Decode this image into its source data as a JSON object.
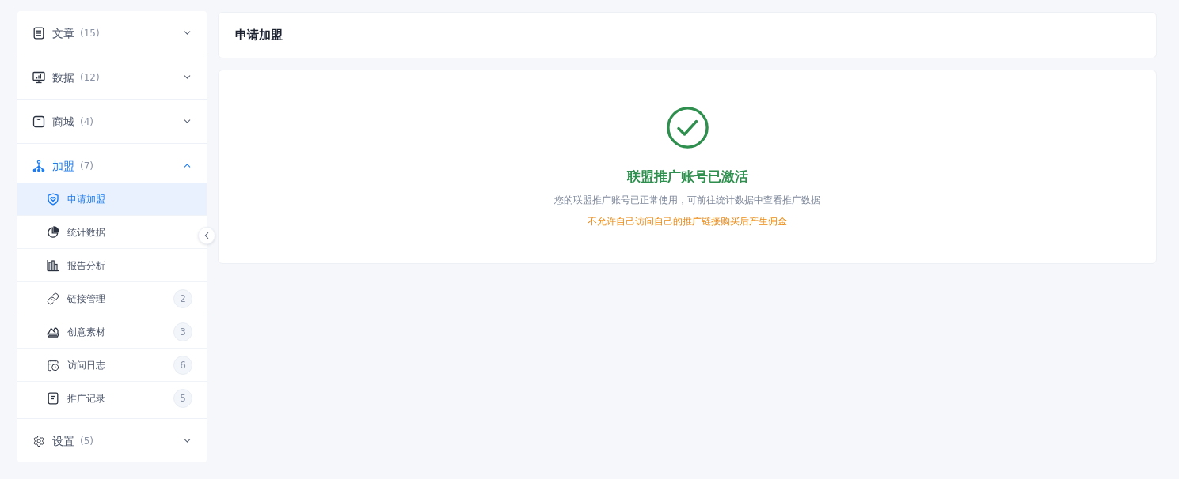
{
  "sidebar": {
    "groups": [
      {
        "label": "文章",
        "count": "(15)",
        "expanded": false,
        "selected": false
      },
      {
        "label": "数据",
        "count": "(12)",
        "expanded": false,
        "selected": false
      },
      {
        "label": "商城",
        "count": "(4)",
        "expanded": false,
        "selected": false
      },
      {
        "label": "加盟",
        "count": "(7)",
        "expanded": true,
        "selected": true,
        "children": [
          {
            "label": "申请加盟",
            "selected": true
          },
          {
            "label": "统计数据",
            "selected": false
          },
          {
            "label": "报告分析",
            "selected": false
          },
          {
            "label": "链接管理",
            "selected": false,
            "badge": "2"
          },
          {
            "label": "创意素材",
            "selected": false,
            "badge": "3"
          },
          {
            "label": "访问日志",
            "selected": false,
            "badge": "6"
          },
          {
            "label": "推广记录",
            "selected": false,
            "badge": "5"
          }
        ]
      },
      {
        "label": "设置",
        "count": "(5)",
        "expanded": false,
        "selected": false
      }
    ]
  },
  "page_header": {
    "title": "申请加盟"
  },
  "result": {
    "kind": "success",
    "title": "联盟推广账号已激活",
    "description": "您的联盟推广账号已正常使用，可前往统计数据中查看推广数据",
    "warning": "不允许自己访问自己的推广链接购买后产生佣金"
  }
}
